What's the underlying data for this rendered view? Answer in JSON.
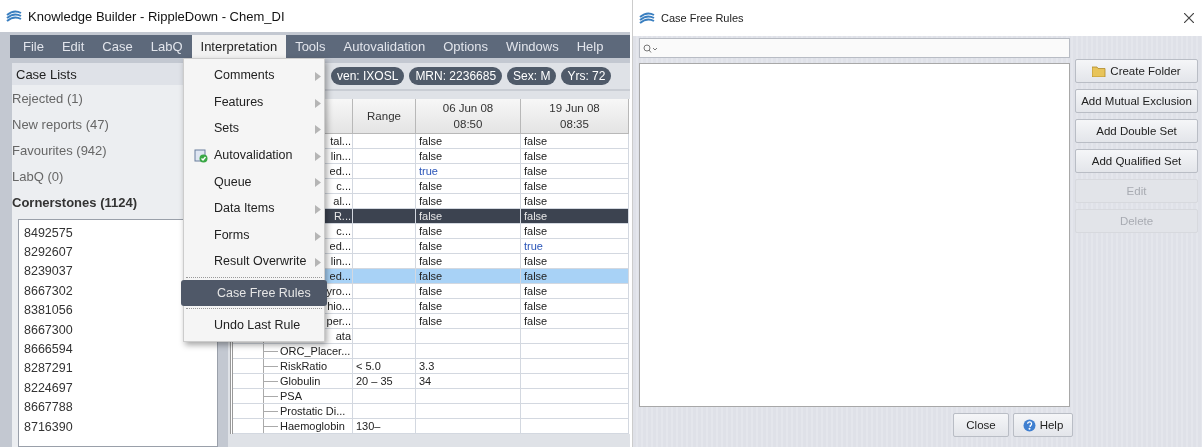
{
  "main_window": {
    "title": "Knowledge Builder - RippleDown - Chem_DI",
    "menu_bar": [
      {
        "label": "File",
        "selected": false
      },
      {
        "label": "Edit",
        "selected": false
      },
      {
        "label": "Case",
        "selected": false
      },
      {
        "label": "LabQ",
        "selected": false
      },
      {
        "label": "Interpretation",
        "selected": true
      },
      {
        "label": "Tools",
        "selected": false
      },
      {
        "label": "Autovalidation",
        "selected": false
      },
      {
        "label": "Options",
        "selected": false
      },
      {
        "label": "Windows",
        "selected": false
      },
      {
        "label": "Help",
        "selected": false
      }
    ],
    "open_menu": [
      {
        "kind": "submenu",
        "label": "Comments",
        "selected": false
      },
      {
        "kind": "submenu",
        "label": "Features",
        "selected": false
      },
      {
        "kind": "submenu",
        "label": "Sets",
        "selected": false
      },
      {
        "kind": "iconsubmenu",
        "label": "Autovalidation",
        "selected": false
      },
      {
        "kind": "submenu",
        "label": "Queue",
        "selected": false
      },
      {
        "kind": "submenu",
        "label": "Data Items",
        "selected": false
      },
      {
        "kind": "submenu",
        "label": "Forms",
        "selected": false
      },
      {
        "kind": "submenu",
        "label": "Result Overwrite",
        "selected": false
      },
      {
        "kind": "separator"
      },
      {
        "kind": "action",
        "label": "Case Free Rules",
        "selected": true
      },
      {
        "kind": "separator"
      },
      {
        "kind": "action",
        "label": "Undo Last Rule",
        "selected": false
      }
    ],
    "case_lists": {
      "header": "Case Lists",
      "items": [
        {
          "label": "Rejected (1)",
          "bold": false
        },
        {
          "label": "New reports (47)",
          "bold": false
        },
        {
          "label": "Favourites (942)",
          "bold": false
        },
        {
          "label": "LabQ (0)",
          "bold": false
        },
        {
          "label": "Cornerstones (1124)",
          "bold": true
        }
      ]
    },
    "cases": [
      "8492575",
      "8292607",
      "8239037",
      "8667302",
      "8381056",
      "8667300",
      "8666594",
      "8287291",
      "8224697",
      "8667788",
      "8716390"
    ],
    "patient_chips": [
      "ven: IXOSL",
      "MRN: 2236685",
      "Sex: M",
      "Yrs: 72"
    ],
    "results_table": {
      "columns": [
        {
          "label": "Range"
        },
        {
          "date": "06 Jun 08",
          "time": "08:50"
        },
        {
          "date": "19 Jun 08",
          "time": "08:35"
        }
      ],
      "rows": [
        {
          "name": "tal...",
          "partial": true,
          "range": "",
          "values": [
            {
              "text": "false",
              "flag": false
            },
            {
              "text": "false",
              "flag": false
            }
          ],
          "selected": false,
          "highlighted": false
        },
        {
          "name": "lin...",
          "partial": true,
          "range": "",
          "values": [
            {
              "text": "false",
              "flag": false
            },
            {
              "text": "false",
              "flag": false
            }
          ],
          "selected": false,
          "highlighted": false
        },
        {
          "name": "ed...",
          "partial": true,
          "range": "",
          "values": [
            {
              "text": "true",
              "flag": true
            },
            {
              "text": "false",
              "flag": false
            }
          ],
          "selected": false,
          "highlighted": false
        },
        {
          "name": "c...",
          "partial": true,
          "range": "",
          "values": [
            {
              "text": "false",
              "flag": false
            },
            {
              "text": "false",
              "flag": false
            }
          ],
          "selected": false,
          "highlighted": false
        },
        {
          "name": "al...",
          "partial": true,
          "range": "",
          "values": [
            {
              "text": "false",
              "flag": false
            },
            {
              "text": "false",
              "flag": false
            }
          ],
          "selected": false,
          "highlighted": false
        },
        {
          "name": "R...",
          "partial": true,
          "range": "",
          "values": [
            {
              "text": "false",
              "flag": false
            },
            {
              "text": "false",
              "flag": false
            }
          ],
          "selected": true,
          "highlighted": false
        },
        {
          "name": "c...",
          "partial": true,
          "range": "",
          "values": [
            {
              "text": "false",
              "flag": false
            },
            {
              "text": "false",
              "flag": false
            }
          ],
          "selected": false,
          "highlighted": false
        },
        {
          "name": "ed...",
          "partial": true,
          "range": "",
          "values": [
            {
              "text": "false",
              "flag": false
            },
            {
              "text": "true",
              "flag": true
            }
          ],
          "selected": false,
          "highlighted": false
        },
        {
          "name": "lin...",
          "partial": true,
          "range": "",
          "values": [
            {
              "text": "false",
              "flag": false
            },
            {
              "text": "false",
              "flag": false
            }
          ],
          "selected": false,
          "highlighted": false
        },
        {
          "name": "ed...",
          "partial": true,
          "range": "",
          "values": [
            {
              "text": "false",
              "flag": false
            },
            {
              "text": "false",
              "flag": false
            }
          ],
          "selected": false,
          "highlighted": true
        },
        {
          "name": "yro...",
          "partial": true,
          "range": "",
          "values": [
            {
              "text": "false",
              "flag": false
            },
            {
              "text": "false",
              "flag": false
            }
          ],
          "selected": false,
          "highlighted": false
        },
        {
          "name": "hio...",
          "partial": true,
          "range": "",
          "values": [
            {
              "text": "false",
              "flag": false
            },
            {
              "text": "false",
              "flag": false
            }
          ],
          "selected": false,
          "highlighted": false
        },
        {
          "name": "per...",
          "partial": true,
          "range": "",
          "values": [
            {
              "text": "false",
              "flag": false
            },
            {
              "text": "false",
              "flag": false
            }
          ],
          "selected": false,
          "highlighted": false
        },
        {
          "name": "ata",
          "partial": true,
          "range": "",
          "values": [],
          "selected": false,
          "highlighted": false
        },
        {
          "name": "ORC_Placer...",
          "partial": false,
          "range": "",
          "values": [],
          "selected": false,
          "highlighted": false
        },
        {
          "name": "RiskRatio",
          "partial": false,
          "range": "< 5.0",
          "values": [
            {
              "text": "3.3",
              "flag": false
            }
          ],
          "selected": false,
          "highlighted": false
        },
        {
          "name": "Globulin",
          "partial": false,
          "range": "20 – 35",
          "values": [
            {
              "text": "34",
              "flag": false
            }
          ],
          "selected": false,
          "highlighted": false
        },
        {
          "name": "PSA",
          "partial": false,
          "range": "",
          "values": [],
          "selected": false,
          "highlighted": false
        },
        {
          "name": "Prostatic Di...",
          "partial": false,
          "range": "",
          "values": [],
          "selected": false,
          "highlighted": false
        },
        {
          "name": "Haemoglobin",
          "partial": false,
          "range": "130–",
          "values": [],
          "selected": false,
          "highlighted": false
        }
      ]
    }
  },
  "dialog": {
    "title": "Case Free Rules",
    "side_buttons": [
      {
        "label": "Create Folder",
        "kind": "folder",
        "disabled": false
      },
      {
        "label": "Add Mutual Exclusion",
        "kind": "plain",
        "disabled": false
      },
      {
        "label": "Add Double Set",
        "kind": "plain",
        "disabled": false
      },
      {
        "label": "Add Qualified Set",
        "kind": "plain",
        "disabled": false
      },
      {
        "label": "Edit",
        "kind": "plain",
        "disabled": true
      },
      {
        "label": "Delete",
        "kind": "plain",
        "disabled": true
      }
    ],
    "footer_buttons": [
      {
        "label": "Close",
        "kind": "plain"
      },
      {
        "label": "Help",
        "kind": "help"
      }
    ]
  }
}
